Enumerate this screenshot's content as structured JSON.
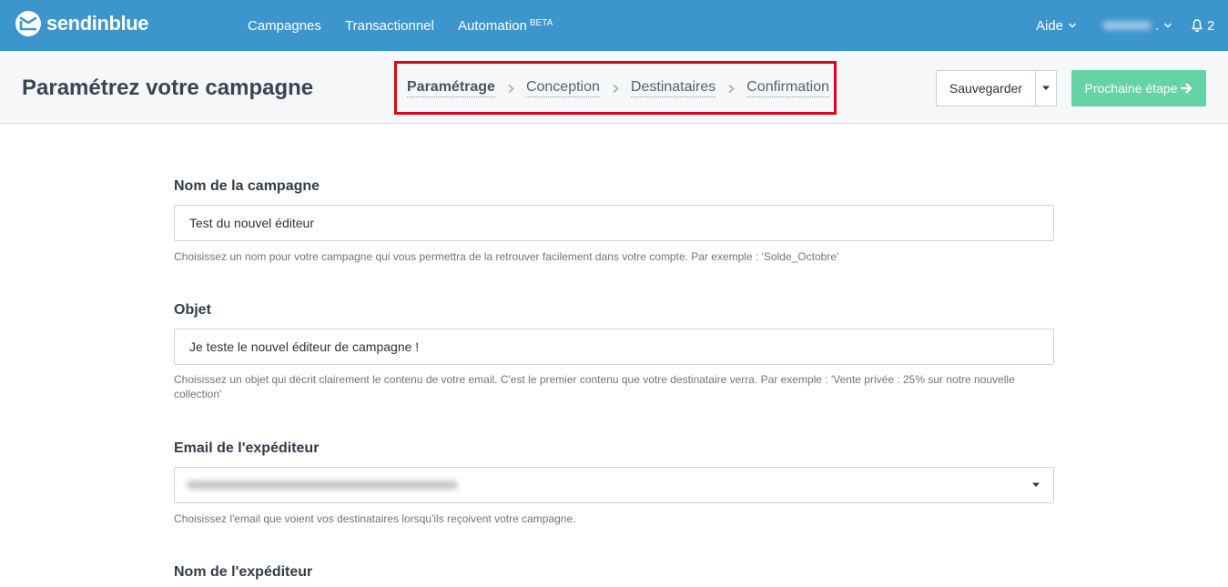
{
  "topbar": {
    "brand": "sendinblue",
    "nav": [
      {
        "label": "Campagnes"
      },
      {
        "label": "Transactionnel"
      },
      {
        "label": "Automation",
        "badge": "BETA"
      }
    ],
    "help": "Aide",
    "notifications_count": "2",
    "background_color": "#3d95ce"
  },
  "header": {
    "title": "Paramétrez votre campagne",
    "steps": [
      "Paramétrage",
      "Conception",
      "Destinataires",
      "Confirmation"
    ],
    "current_step": "Paramétrage",
    "save_label": "Sauvegarder",
    "next_label": "Prochaine étape",
    "highlight_color": "#e3001b",
    "next_button_color": "#65d3a6"
  },
  "form": {
    "campaign_name": {
      "label": "Nom de la campagne",
      "value": "Test du nouvel éditeur",
      "hint": "Choisissez un nom pour votre campagne qui vous permettra de la retrouver facilement dans votre compte. Par exemple : 'Solde_Octobre'"
    },
    "subject": {
      "label": "Objet",
      "value": "Je teste le nouvel éditeur de campagne !",
      "hint": "Choisissez un objet qui décrit clairement le contenu de votre email. C'est le premier contenu que votre destinataire verra. Par exemple : 'Vente privée : 25% sur notre nouvelle collection'"
    },
    "sender_email": {
      "label": "Email de l'expéditeur",
      "hint": "Choisissez l'email que voient vos destinataires lorsqu'ils reçoivent votre campagne."
    },
    "sender_name": {
      "label": "Nom de l'expéditeur"
    }
  }
}
